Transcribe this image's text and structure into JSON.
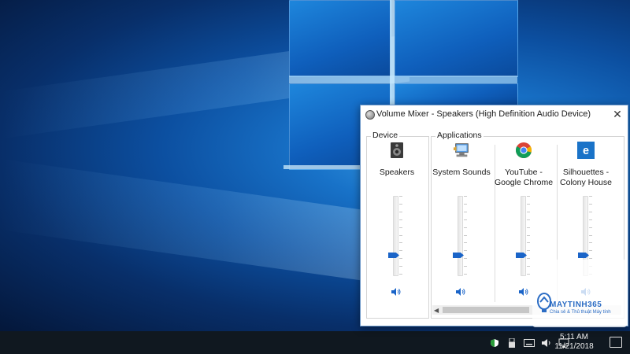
{
  "window": {
    "title": "Volume Mixer - Speakers (High Definition Audio Device)",
    "close_label": "✕"
  },
  "groups": {
    "device": "Device",
    "applications": "Applications"
  },
  "channels": [
    {
      "name": "Speakers",
      "line1": "Speakers",
      "line2": "",
      "icon": "speaker-device-icon",
      "level": 0.25
    },
    {
      "name": "System Sounds",
      "line1": "System Sounds",
      "line2": "",
      "icon": "system-sounds-icon",
      "level": 0.25
    },
    {
      "name": "YouTube - Google Chrome",
      "line1": "YouTube -",
      "line2": "Google Chrome",
      "icon": "chrome-icon",
      "level": 0.25
    },
    {
      "name": "Silhouettes - Colony House",
      "line1": "Silhouettes -",
      "line2": "Colony House",
      "icon": "edge-icon",
      "level": 0.25
    }
  ],
  "taskbar": {
    "time": "5:11 AM",
    "date": "11/21/2018"
  },
  "watermark": {
    "brand": "MAYTINH365",
    "tagline": "Chia sẻ & Thủ thuật Máy tính"
  },
  "colors": {
    "accent": "#1a64c8",
    "taskbar": "#101820"
  }
}
